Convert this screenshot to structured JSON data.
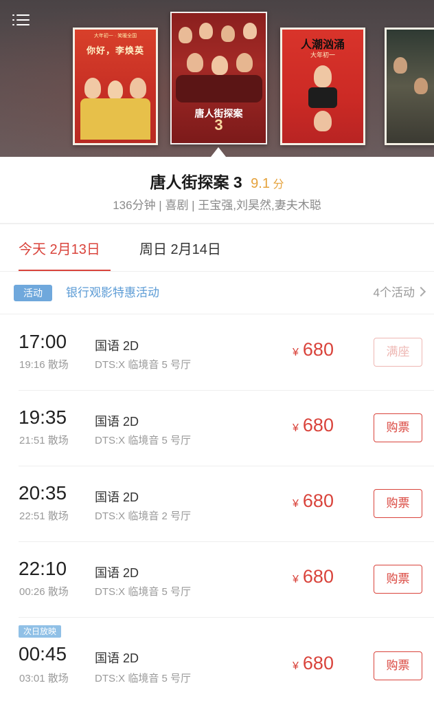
{
  "header": {
    "menu_icon": "menu-list-icon",
    "posters": [
      {
        "title": "你好，李焕英",
        "subtitle": "大年初一 · 笑暖全国"
      },
      {
        "title": "唐人街探案",
        "number": "3"
      },
      {
        "title": "人潮汹涌",
        "subtitle": "大年初一"
      },
      {
        "title": ""
      }
    ]
  },
  "movie": {
    "title": "唐人街探案 3",
    "score": "9.1",
    "score_unit": "分",
    "meta": "136分钟 | 喜剧 | 王宝强,刘昊然,妻夫木聪"
  },
  "tabs": [
    {
      "label": "今天 2月13日",
      "active": true
    },
    {
      "label": "周日 2月14日",
      "active": false
    }
  ],
  "promo": {
    "badge": "活动",
    "text": "银行观影特惠活动",
    "count": "4个活动"
  },
  "currency_symbol": "¥",
  "next_day_badge": "次日放映",
  "showtimes": [
    {
      "start": "17:00",
      "end": "19:16 散场",
      "lang": "国语 2D",
      "hall": "DTS:X 临境音 5 号厅",
      "price": "680",
      "button": "满座",
      "sold_out": true
    },
    {
      "start": "19:35",
      "end": "21:51 散场",
      "lang": "国语 2D",
      "hall": "DTS:X 临境音 5 号厅",
      "price": "680",
      "button": "购票",
      "sold_out": false
    },
    {
      "start": "20:35",
      "end": "22:51 散场",
      "lang": "国语 2D",
      "hall": "DTS:X 临境音 2 号厅",
      "price": "680",
      "button": "购票",
      "sold_out": false
    },
    {
      "start": "22:10",
      "end": "00:26 散场",
      "lang": "国语 2D",
      "hall": "DTS:X 临境音 5 号厅",
      "price": "680",
      "button": "购票",
      "sold_out": false
    },
    {
      "start": "00:45",
      "end": "03:01 散场",
      "lang": "国语 2D",
      "hall": "DTS:X 临境音 5 号厅",
      "price": "680",
      "button": "购票",
      "sold_out": false,
      "next_day": true
    }
  ],
  "colors": {
    "accent": "#d9433b",
    "score": "#e5a23b",
    "link": "#5b9bd5",
    "badge": "#6fa8dc"
  }
}
